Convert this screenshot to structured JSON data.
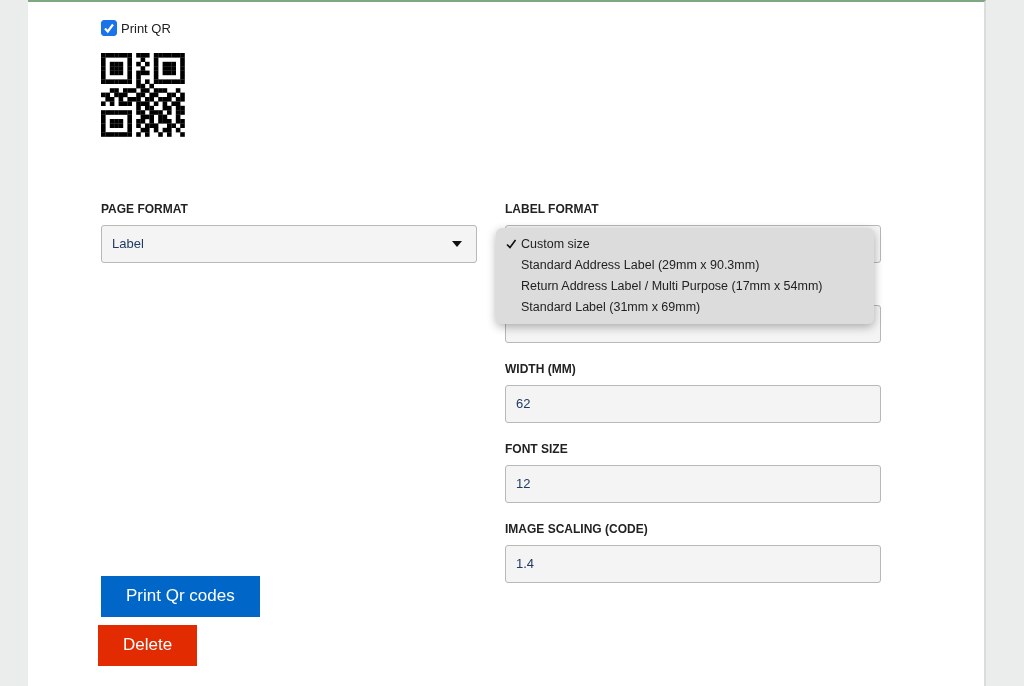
{
  "print_qr": {
    "label": "Print QR",
    "checked": true
  },
  "page_format": {
    "label": "PAGE FORMAT",
    "value": "Label"
  },
  "label_format": {
    "label": "LABEL FORMAT",
    "options": [
      {
        "label": "Custom size",
        "selected": true
      },
      {
        "label": "Standard Address Label (29mm x 90.3mm)",
        "selected": false
      },
      {
        "label": "Return Address Label / Multi Purpose (17mm x 54mm)",
        "selected": false
      },
      {
        "label": "Standard Label (31mm x 69mm)",
        "selected": false
      }
    ]
  },
  "fields": [
    {
      "label": "WIDTH (MM)",
      "value": "62"
    },
    {
      "label": "FONT SIZE",
      "value": "12"
    },
    {
      "label": "IMAGE SCALING (CODE)",
      "value": "1.4"
    }
  ],
  "buttons": [
    {
      "kind": "primary",
      "label": "Print Qr codes"
    },
    {
      "kind": "danger",
      "label": "Delete"
    }
  ]
}
